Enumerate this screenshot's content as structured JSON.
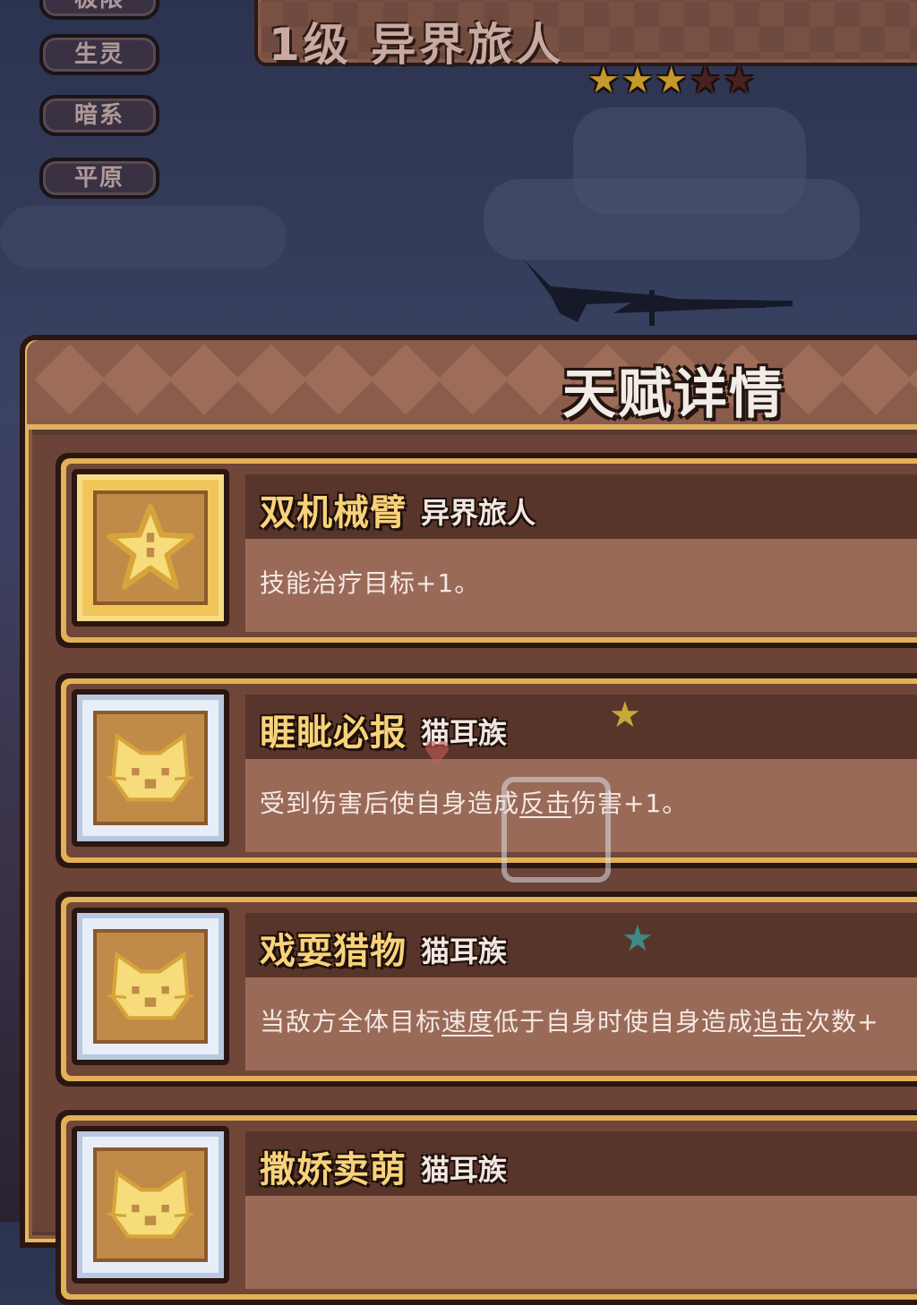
{
  "filters": {
    "partial_top": "极限",
    "items": [
      "生灵",
      "暗系",
      "平原"
    ]
  },
  "hero": {
    "title": "1级 异界旅人",
    "stars_on": 3,
    "stars_total": 5
  },
  "panel": {
    "title": "天赋详情"
  },
  "talents": [
    {
      "name": "双机械臂",
      "tag": "异界旅人",
      "frame": "gold",
      "icon": "star-icon",
      "desc": [
        {
          "t": "技能治疗目标+1。"
        }
      ]
    },
    {
      "name": "睚眦必报",
      "tag": "猫耳族",
      "frame": "silver",
      "icon": "cat-face-icon",
      "desc": [
        {
          "t": "受到伤害后使自身造成"
        },
        {
          "t": "反击",
          "u": true
        },
        {
          "t": "伤害+1。"
        }
      ]
    },
    {
      "name": "戏耍猎物",
      "tag": "猫耳族",
      "frame": "silver",
      "icon": "cat-face-icon",
      "desc": [
        {
          "t": "当敌方全体目标"
        },
        {
          "t": "速度",
          "u": true
        },
        {
          "t": "低于自身时使自身造成"
        },
        {
          "t": "追击",
          "u": true
        },
        {
          "t": "次数+"
        }
      ]
    },
    {
      "name": "撒娇卖萌",
      "tag": "猫耳族",
      "frame": "silver",
      "icon": "cat-face-icon",
      "desc": []
    }
  ],
  "colors": {
    "accent_gold": "#e2b156",
    "name_yellow": "#f8d27a",
    "star_on": "#c49a2c",
    "star_off": "#4a2020"
  }
}
